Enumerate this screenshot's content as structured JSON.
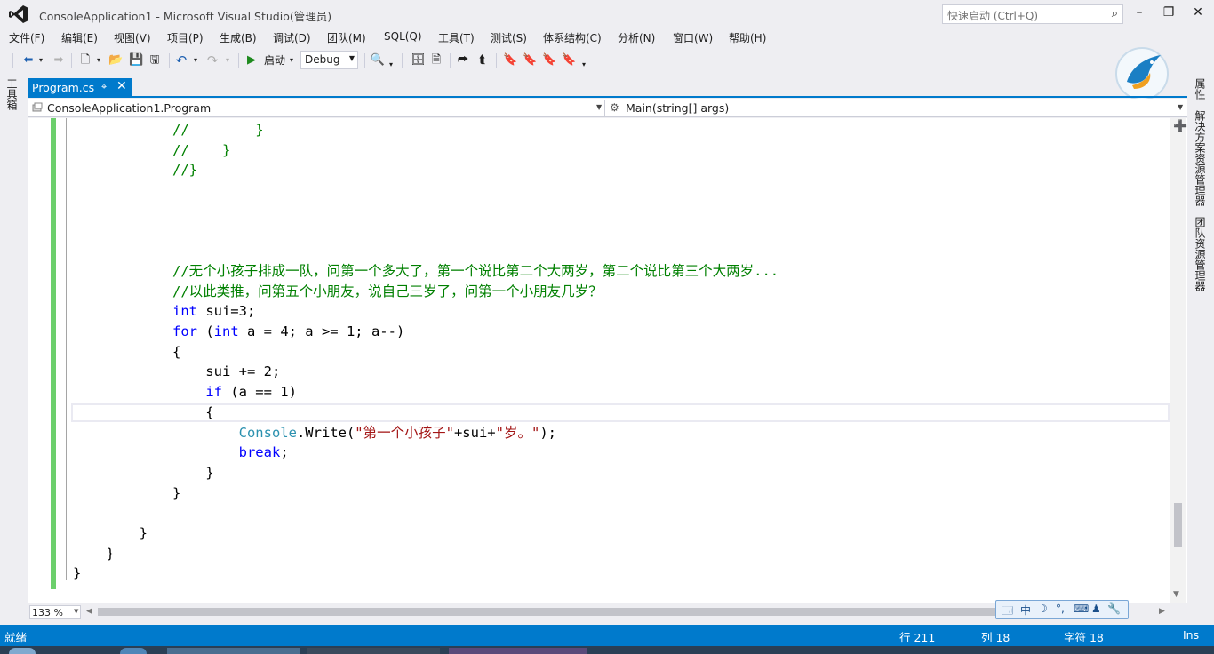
{
  "window": {
    "title": "ConsoleApplication1 - Microsoft Visual Studio(管理员)",
    "quick_launch_placeholder": "快速启动 (Ctrl+Q)"
  },
  "menu": [
    "文件(F)",
    "编辑(E)",
    "视图(V)",
    "项目(P)",
    "生成(B)",
    "调试(D)",
    "团队(M)",
    "SQL(Q)",
    "工具(T)",
    "测试(S)",
    "体系结构(C)",
    "分析(N)",
    "窗口(W)",
    "帮助(H)"
  ],
  "toolbar": {
    "start_label": "启动",
    "config": "Debug"
  },
  "side_panels": {
    "left": "工具箱",
    "right": [
      "属性",
      "解决方案资源管理器",
      "团队资源管理器"
    ]
  },
  "tab": {
    "label": "Program.cs"
  },
  "navbar": {
    "class": "ConsoleApplication1.Program",
    "member": "Main(string[] args)"
  },
  "code": [
    [
      {
        "c": "cm",
        "t": "            //        }"
      }
    ],
    [
      {
        "c": "cm",
        "t": "            //    }"
      }
    ],
    [
      {
        "c": "cm",
        "t": "            //}"
      }
    ],
    [],
    [],
    [],
    [],
    [
      {
        "c": "cm",
        "t": "            //无个小孩子排成一队，问第一个多大了，第一个说比第二个大两岁，第二个说比第三个大两岁..."
      }
    ],
    [
      {
        "c": "cm",
        "t": "            //以此类推，问第五个小朋友，说自己三岁了，问第一个小朋友几岁？"
      }
    ],
    [
      {
        "c": "pl",
        "t": "            "
      },
      {
        "c": "kw",
        "t": "int"
      },
      {
        "c": "pl",
        "t": " sui=3;"
      }
    ],
    [
      {
        "c": "pl",
        "t": "            "
      },
      {
        "c": "kw",
        "t": "for"
      },
      {
        "c": "pl",
        "t": " ("
      },
      {
        "c": "kw",
        "t": "int"
      },
      {
        "c": "pl",
        "t": " a = 4; a >= 1; a--)"
      }
    ],
    [
      {
        "c": "pl",
        "t": "            {"
      }
    ],
    [
      {
        "c": "pl",
        "t": "                sui += 2;"
      }
    ],
    [
      {
        "c": "pl",
        "t": "                "
      },
      {
        "c": "kw",
        "t": "if"
      },
      {
        "c": "pl",
        "t": " (a == 1)"
      }
    ],
    [
      {
        "c": "pl",
        "t": "                {"
      }
    ],
    [
      {
        "c": "pl",
        "t": "                    "
      },
      {
        "c": "ty",
        "t": "Console"
      },
      {
        "c": "pl",
        "t": ".Write("
      },
      {
        "c": "st",
        "t": "\"第一个小孩子\""
      },
      {
        "c": "pl",
        "t": "+sui+"
      },
      {
        "c": "st",
        "t": "\"岁。\""
      },
      {
        "c": "pl",
        "t": ");"
      }
    ],
    [
      {
        "c": "pl",
        "t": "                    "
      },
      {
        "c": "kw",
        "t": "break"
      },
      {
        "c": "pl",
        "t": ";"
      }
    ],
    [
      {
        "c": "pl",
        "t": "                }"
      }
    ],
    [
      {
        "c": "pl",
        "t": "            }"
      }
    ],
    [],
    [
      {
        "c": "pl",
        "t": "        }"
      }
    ],
    [
      {
        "c": "pl",
        "t": "    }"
      }
    ],
    [
      {
        "c": "pl",
        "t": "}"
      }
    ]
  ],
  "editor": {
    "zoom": "133 %"
  },
  "ime": [
    "中",
    "☽",
    "°,",
    "⌨",
    "♟",
    "🔧"
  ],
  "status": {
    "left": "就绪",
    "line": "行 211",
    "col": "列 18",
    "char": "字符 18",
    "mode": "Ins"
  },
  "colors": {
    "accent": "#007acc",
    "comment": "#008000",
    "keyword": "#0000ff",
    "type": "#2b91af",
    "string": "#a31515",
    "change_bar": "#6ccf6c"
  }
}
